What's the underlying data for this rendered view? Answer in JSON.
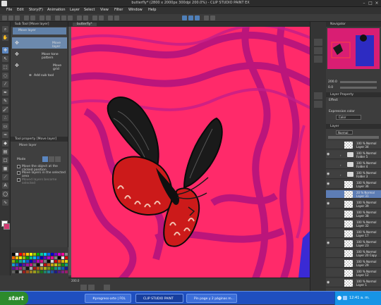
{
  "window": {
    "title": "butterfly* (2800 x 2000px 300dpi 200.0%) - CLIP STUDIO PAINT EX",
    "controls": [
      "–",
      "□",
      "×"
    ]
  },
  "menu": [
    "File",
    "Edit",
    "Story(F)",
    "Animation",
    "Layer",
    "Select",
    "View",
    "Filter",
    "Window",
    "Help"
  ],
  "subtool_panel": {
    "header": "Sub Tool [Move layer]",
    "tab": "Move layer",
    "items": [
      "Move layer",
      "Move tone pattern",
      "Move grid"
    ],
    "add": "Add sub tool"
  },
  "tool_property": {
    "header": "Tool property [Move layer]",
    "name": "Move layer",
    "mode_label": "Mode",
    "options": [
      "Move the object at the clicked position",
      "Move layers in the selected area",
      "Moved layers become selected"
    ]
  },
  "canvas": {
    "tab": "butterfly*",
    "zoom": "200.0",
    "bg_color": "#ff2a6a",
    "swirl_color": "#b0127e"
  },
  "navigator": {
    "header": "Navigator",
    "zoom": "200.0",
    "angle": "0.0"
  },
  "layer_property": {
    "header": "Layer Property",
    "effect_label": "Effect",
    "expression_label": "Expression color",
    "expression_value": "Color"
  },
  "layers_panel": {
    "header": "Layer",
    "blend": "Normal",
    "layers": [
      {
        "pct": "100 %",
        "mode": "Normal",
        "name": "Layer 34",
        "type": "layer",
        "visible": false,
        "selected": false
      },
      {
        "pct": "100 %",
        "mode": "Normal",
        "name": "Folder 5",
        "type": "folder",
        "visible": true,
        "selected": false
      },
      {
        "pct": "100 %",
        "mode": "Normal",
        "name": "Folder 4",
        "type": "folder",
        "visible": false,
        "selected": false
      },
      {
        "pct": "100 %",
        "mode": "Normal",
        "name": "Folder 3",
        "type": "folder",
        "visible": true,
        "selected": false
      },
      {
        "pct": "100 %",
        "mode": "Normal",
        "name": "Layer 36",
        "type": "layer",
        "visible": true,
        "selected": false
      },
      {
        "pct": "20 %",
        "mode": "Normal",
        "name": "Layer 31",
        "type": "layer",
        "visible": false,
        "selected": true
      },
      {
        "pct": "100 %",
        "mode": "Normal",
        "name": "Layer 39",
        "type": "layer",
        "visible": true,
        "selected": false
      },
      {
        "pct": "100 %",
        "mode": "Normal",
        "name": "Layer 38",
        "type": "layer",
        "visible": false,
        "selected": false
      },
      {
        "pct": "100 %",
        "mode": "Normal",
        "name": "Layer 32",
        "type": "layer",
        "visible": false,
        "selected": false
      },
      {
        "pct": "100 %",
        "mode": "Normal",
        "name": "Layer 17",
        "type": "layer",
        "visible": false,
        "selected": false
      },
      {
        "pct": "100 %",
        "mode": "Normal",
        "name": "Layer 23",
        "type": "layer",
        "visible": true,
        "selected": false
      },
      {
        "pct": "100 %",
        "mode": "Normal",
        "name": "Layer 20 Copy",
        "type": "layer",
        "visible": false,
        "selected": false
      },
      {
        "pct": "100 %",
        "mode": "Normal",
        "name": "Layer 29",
        "type": "layer",
        "visible": false,
        "selected": false
      },
      {
        "pct": "100 %",
        "mode": "Normal",
        "name": "Layer 12",
        "type": "layer",
        "visible": false,
        "selected": false
      },
      {
        "pct": "100 %",
        "mode": "Normal",
        "name": "Layer 1",
        "type": "layer",
        "visible": true,
        "selected": false
      }
    ]
  },
  "taskbar": {
    "start": "start",
    "tasks": [
      "#progress-arte | FOL",
      "CLIP STUDIO PAINT",
      "Pin page y 2 páginas m..."
    ],
    "active_task": 1,
    "clock": "12:41 a. m."
  }
}
